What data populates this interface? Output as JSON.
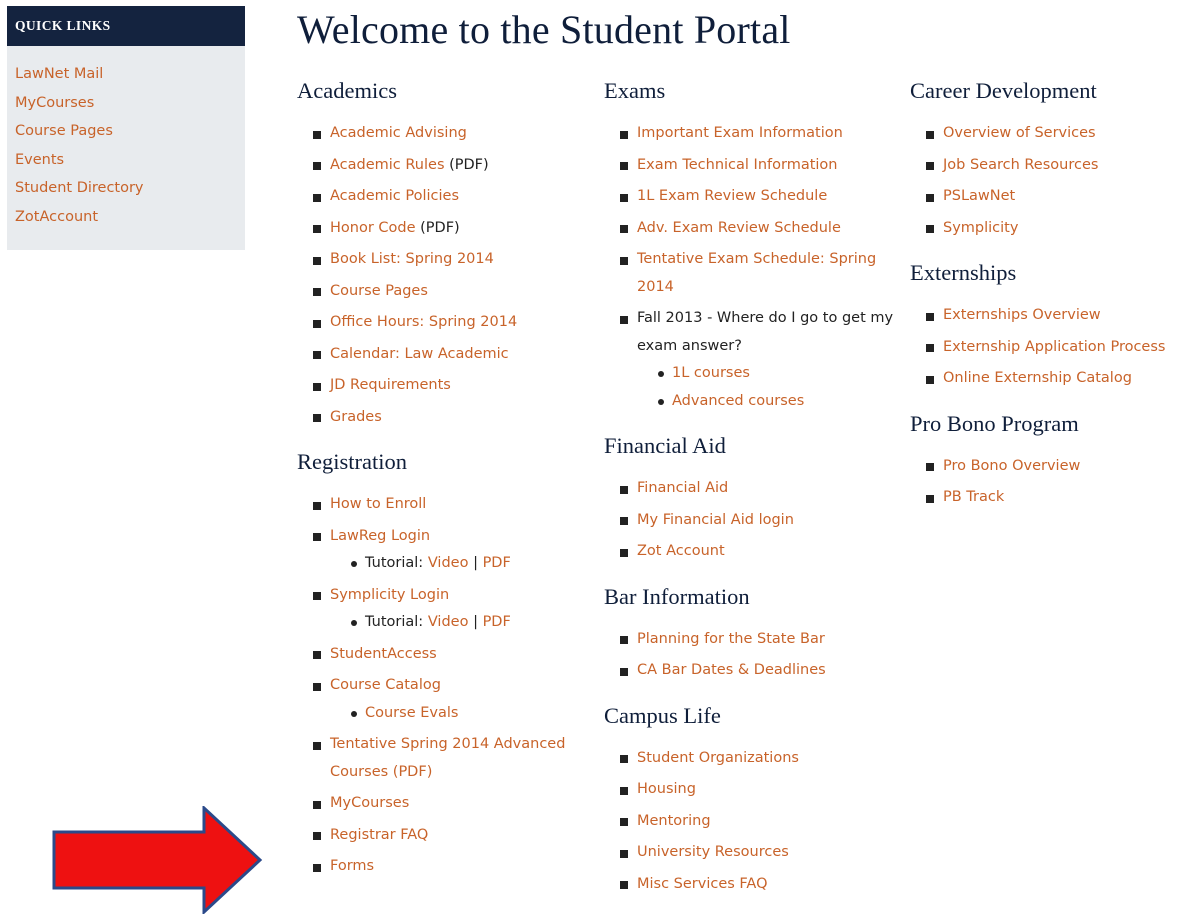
{
  "quick_links": {
    "title": "QUICK LINKS",
    "items": [
      "LawNet Mail",
      "MyCourses",
      "Course Pages",
      "Events",
      "Student Directory",
      "ZotAccount"
    ]
  },
  "page_title": "Welcome to the Student Portal",
  "academics": {
    "title": "Academics",
    "items": [
      {
        "label": "Academic Advising"
      },
      {
        "label": "Academic Rules",
        "suffix": "(PDF)"
      },
      {
        "label": "Academic Policies"
      },
      {
        "label": "Honor Code",
        "suffix": "(PDF)"
      },
      {
        "label": "Book List: Spring 2014"
      },
      {
        "label": "Course Pages"
      },
      {
        "label": "Office Hours: Spring 2014"
      },
      {
        "label": "Calendar: Law Academic"
      },
      {
        "label": "JD Requirements"
      },
      {
        "label": "Grades"
      }
    ]
  },
  "registration": {
    "title": "Registration",
    "how_to_enroll": "How to Enroll",
    "lawreg_login": "LawReg Login",
    "tutorial_prefix": "Tutorial:",
    "video": "Video",
    "pdf": "PDF",
    "separator": "|",
    "symplicity_login": "Symplicity Login",
    "studentaccess": "StudentAccess",
    "course_catalog": "Course Catalog",
    "course_evals": "Course Evals",
    "tentative_spring": "Tentative Spring 2014 Advanced Courses (PDF)",
    "mycourses": "MyCourses",
    "registrar_faq": "Registrar FAQ",
    "forms": "Forms"
  },
  "exams": {
    "title": "Exams",
    "items": [
      "Important Exam Information",
      "Exam Technical Information",
      "1L Exam Review Schedule",
      "Adv. Exam Review Schedule",
      "Tentative Exam Schedule: Spring 2014"
    ],
    "fall_question": "Fall 2013 - Where do I go to get my exam answer?",
    "sub_items": [
      "1L courses",
      "Advanced courses"
    ]
  },
  "financial_aid": {
    "title": "Financial Aid",
    "items": [
      "Financial Aid",
      "My Financial Aid login",
      "Zot Account"
    ]
  },
  "bar_information": {
    "title": "Bar Information",
    "items": [
      "Planning for the State Bar",
      "CA Bar Dates & Deadlines"
    ]
  },
  "campus_life": {
    "title": "Campus Life",
    "items": [
      "Student Organizations",
      "Housing",
      "Mentoring",
      "University Resources",
      "Misc Services FAQ"
    ]
  },
  "career_development": {
    "title": "Career Development",
    "items": [
      "Overview of Services",
      "Job Search Resources",
      "PSLawNet",
      "Symplicity"
    ]
  },
  "externships": {
    "title": "Externships",
    "items": [
      "Externships Overview",
      "Externship Application Process",
      "Online Externship Catalog"
    ]
  },
  "pro_bono": {
    "title": "Pro Bono Program",
    "items": [
      "Pro Bono Overview",
      "PB Track"
    ]
  },
  "colors": {
    "link": "#c8632a",
    "heading": "#0f1e3a",
    "sidebar_header_bg": "#14233f",
    "sidebar_bg": "#e8ebee",
    "arrow_fill": "#ee1111",
    "arrow_stroke": "#2b4a8a"
  },
  "annotation": {
    "icon": "red-arrow-icon"
  }
}
